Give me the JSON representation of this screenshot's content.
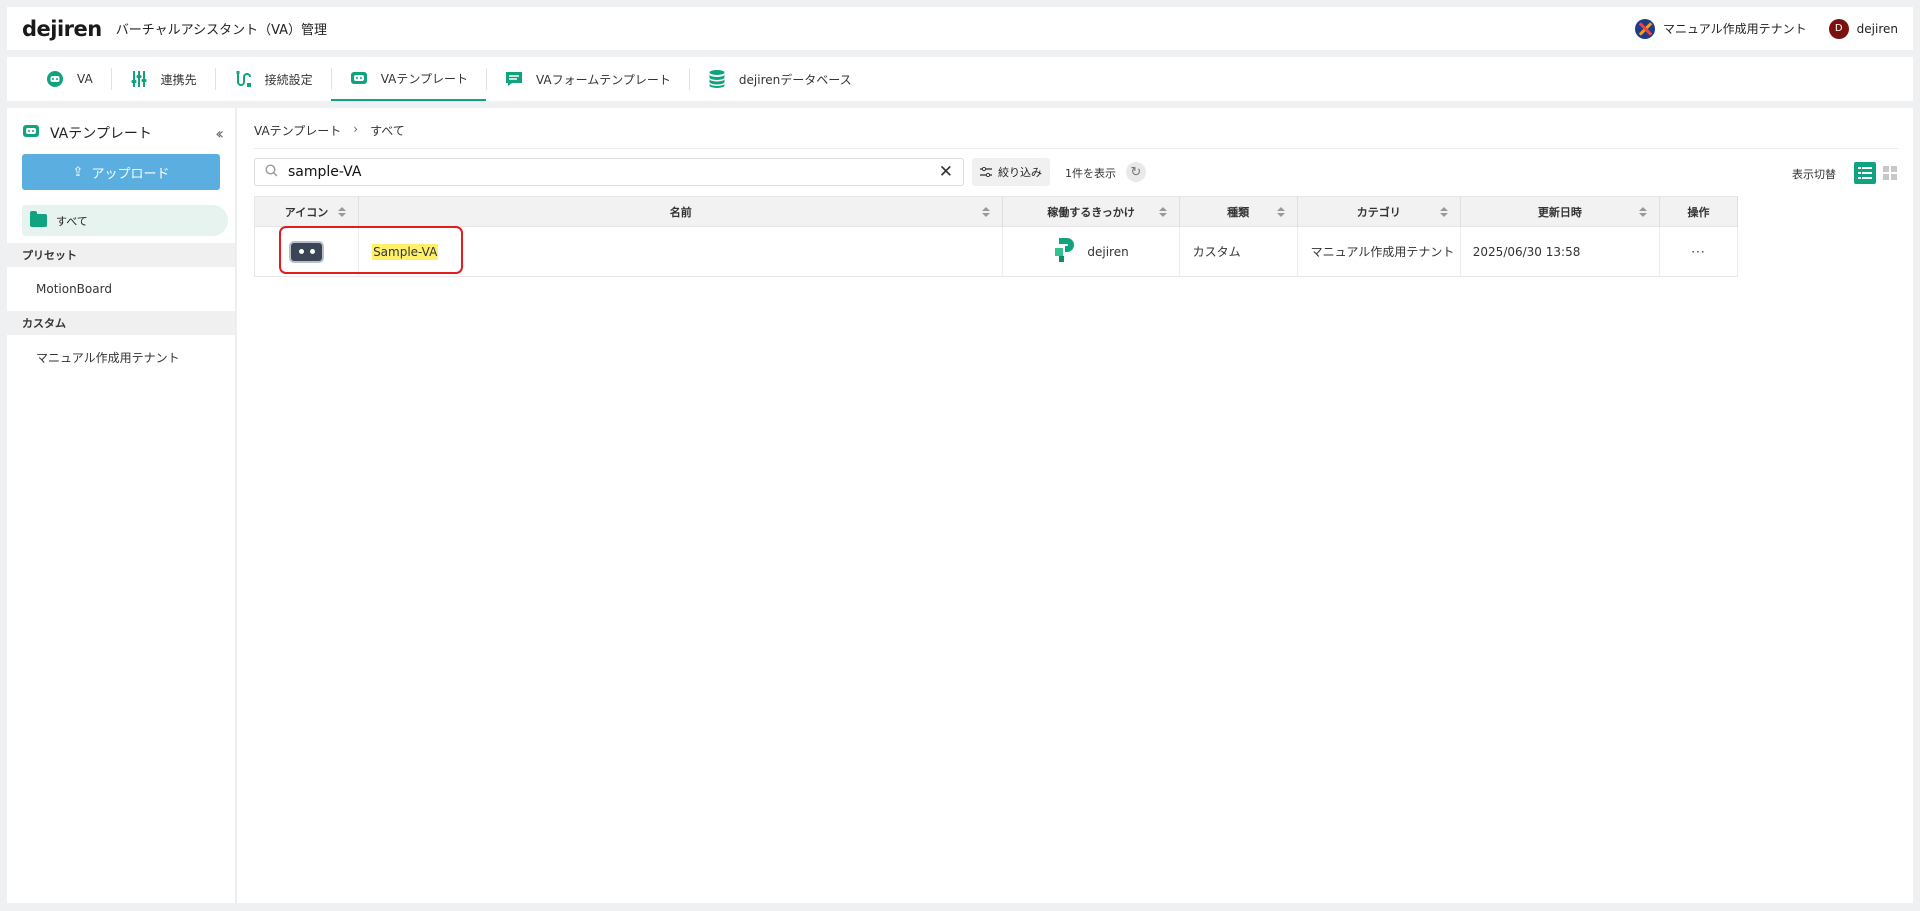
{
  "header": {
    "logo": "dejiren",
    "title": "バーチャルアシスタント（VA）管理",
    "tenant": "マニュアル作成用テナント",
    "user_initial": "D",
    "user_name": "dejiren"
  },
  "tabs": [
    {
      "label": "VA",
      "icon": "robot-face-icon"
    },
    {
      "label": "連携先",
      "icon": "sliders-icon"
    },
    {
      "label": "接続設定",
      "icon": "connection-icon"
    },
    {
      "label": "VAテンプレート",
      "icon": "robot-template-icon",
      "active": true
    },
    {
      "label": "VAフォームテンプレート",
      "icon": "form-icon"
    },
    {
      "label": "dejirenデータベース",
      "icon": "database-icon"
    }
  ],
  "sidebar": {
    "title": "VAテンプレート",
    "upload_label": "アップロード",
    "all_label": "すべて",
    "sections": [
      {
        "label": "プリセット",
        "items": [
          "MotionBoard"
        ]
      },
      {
        "label": "カスタム",
        "items": [
          "マニュアル作成用テナント"
        ]
      }
    ]
  },
  "breadcrumb": [
    "VAテンプレート",
    "すべて"
  ],
  "breadcrumb_sep": "›",
  "toolbar": {
    "search_value": "sample-VA",
    "filter_label": "絞り込み",
    "count_label": "1件を表示",
    "view_label": "表示切替"
  },
  "table": {
    "columns": [
      "アイコン",
      "名前",
      "稼働するきっかけ",
      "種類",
      "カテゴリ",
      "更新日時",
      "操作"
    ],
    "rows": [
      {
        "name": "Sample-VA",
        "trigger": "dejiren",
        "type": "カスタム",
        "category": "マニュアル作成用テナント",
        "updated": "2025/06/30 13:58",
        "ops": "···"
      }
    ]
  },
  "colors": {
    "accent": "#10a37f",
    "upload": "#5aaee0",
    "highlight": "#fff06a",
    "annotation": "#e11d1d"
  }
}
